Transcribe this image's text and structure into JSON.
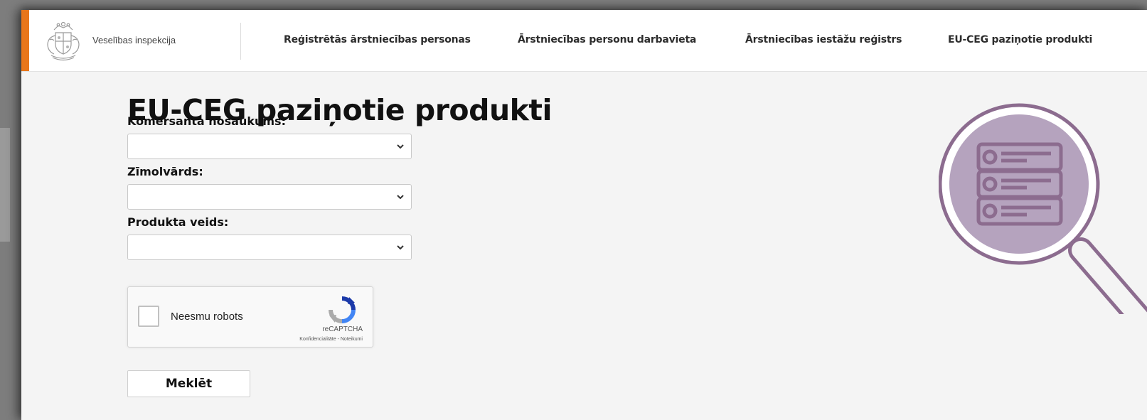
{
  "header": {
    "brand": "Veselības inspekcija",
    "nav": [
      {
        "label": "Reģistrētās ārstniecības personas"
      },
      {
        "label": "Ārstniecības personu darbavieta"
      },
      {
        "label": "Ārstniecības iestāžu reģistrs"
      },
      {
        "label": "EU-CEG paziņotie produkti"
      }
    ]
  },
  "main": {
    "title": "EU-CEG paziņotie produkti",
    "fields": [
      {
        "label": "Komersanta nosaukums:",
        "value": ""
      },
      {
        "label": "Zīmolvārds:",
        "value": ""
      },
      {
        "label": "Produkta veids:",
        "value": ""
      }
    ],
    "captcha": {
      "label": "Neesmu robots",
      "brand": "reCAPTCHA",
      "links": "Konfidencialitāte - Noteikumi",
      "checked": false
    },
    "search_button": "Meklēt"
  },
  "colors": {
    "accent": "#e8761a",
    "illustration_fill": "#b5a3be",
    "illustration_stroke": "#8c6c8f"
  },
  "icons": [
    "coat-of-arms-logo",
    "chevron-down-icon",
    "recaptcha-icon",
    "database-search-icon"
  ]
}
